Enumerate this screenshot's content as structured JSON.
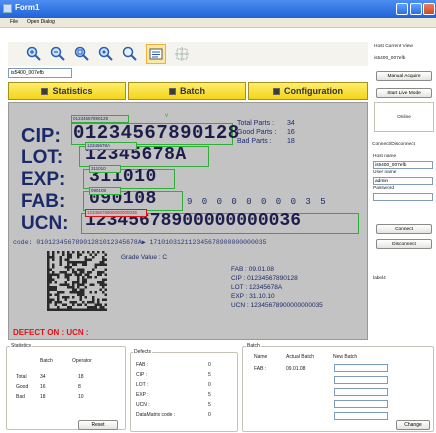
{
  "window": {
    "title": "Form1"
  },
  "menu": [
    "File",
    "Open Dialog"
  ],
  "toolbar": {
    "buttons": [
      {
        "icon": "zoom-in-icon"
      },
      {
        "icon": "zoom-out-icon"
      },
      {
        "icon": "zoom-fit-icon"
      },
      {
        "icon": "zoom-area-icon"
      },
      {
        "icon": "search-icon"
      },
      {
        "icon": "image-view-icon"
      },
      {
        "icon": "crop-icon"
      }
    ]
  },
  "device_field": "is5400_007efb",
  "tabs": [
    {
      "label": "Statistics"
    },
    {
      "label": "Batch"
    },
    {
      "label": "Configuration"
    }
  ],
  "image": {
    "lines": [
      {
        "key": "CIP",
        "value": "01234567890128"
      },
      {
        "key": "LOT",
        "value": "12345678A"
      },
      {
        "key": "EXP",
        "value": "311010"
      },
      {
        "key": "FAB",
        "value": "090108"
      },
      {
        "key": "UCN",
        "value": "12345678900000000036"
      }
    ],
    "small_box_labels": [
      "01234567890128",
      "12345678A",
      "311010",
      "090108",
      "12345678900000000036"
    ],
    "fab_trail": "9 0 0 0 0 0 0 0 3 5",
    "stats": [
      {
        "label": "Total Parts :",
        "value": "34"
      },
      {
        "label": "Good Parts :",
        "value": "16"
      },
      {
        "label": "Bad Parts :",
        "value": "18"
      }
    ],
    "code_line": "code: 0101234567890128101234567​8A▶ 171010312112345678900000000035",
    "grade": "Grade Value : C",
    "info": [
      "FAB : 09.01.08",
      "CIP : 01234567890128",
      "LOT : 12345678A",
      "EXP : 31.10.10",
      "UCN : 12345678900000000035"
    ],
    "defect": "DEFECT ON : UCN :"
  },
  "right_panel": {
    "host_view_label": "Host Current View",
    "host_view_value": "is5400_007efb",
    "manual_acquire": "Manual Acquire",
    "start_live": "Start Live Mode",
    "online": "Online",
    "connect_group": "Connect/Disconnect",
    "host_name_label": "Host name",
    "host_name_value": "is5400_007efb",
    "user_name_label": "User name",
    "user_name_value": "admin",
    "password_label": "Password",
    "connect": "Connect",
    "disconnect": "Disconnect",
    "label4": "label4"
  },
  "statistics": {
    "title": "Statistics",
    "col_batch": "Batch",
    "col_operator": "Operator",
    "rows": [
      {
        "label": "Total",
        "batch": "34",
        "operator": "18"
      },
      {
        "label": "Good",
        "batch": "16",
        "operator": "8"
      },
      {
        "label": "Bad",
        "batch": "18",
        "operator": "10"
      }
    ],
    "reset": "Reset"
  },
  "defects": {
    "title": "Defects",
    "rows": [
      {
        "label": "FAB :",
        "value": "0"
      },
      {
        "label": "CIP :",
        "value": "5"
      },
      {
        "label": "LOT :",
        "value": "0"
      },
      {
        "label": "EXP :",
        "value": "5"
      },
      {
        "label": "UCN :",
        "value": "5"
      },
      {
        "label": "DataMatrix code :",
        "value": "0"
      }
    ]
  },
  "batch": {
    "title": "Batch",
    "col_name": "Name",
    "col_actual": "Actual Batch",
    "col_new": "New Batch",
    "row_name": "FAB :",
    "row_actual": "09.01.08",
    "change": "Change"
  }
}
